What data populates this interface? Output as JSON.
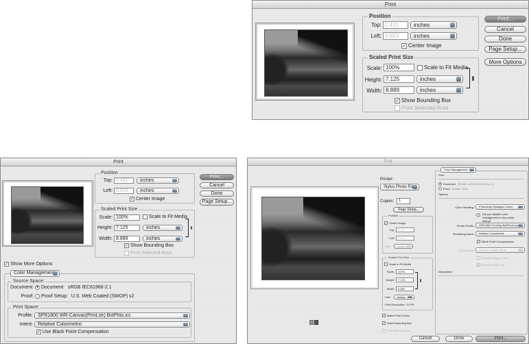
{
  "top": {
    "title": "Print",
    "position": {
      "legend": "Position",
      "top_label": "Top:",
      "top_value": "0.431",
      "left_label": "Left:",
      "left_value": "0.653",
      "unit": "inches",
      "center_image": "Center Image"
    },
    "scaled": {
      "legend": "Scaled Print Size",
      "scale_label": "Scale:",
      "scale_value": "100%",
      "fit": "Scale to Fit Media",
      "height_label": "Height:",
      "height_value": "7.125",
      "width_label": "Width:",
      "width_value": "8.889",
      "unit": "inches",
      "bbox": "Show Bounding Box",
      "selected": "Print Selected Area"
    },
    "buttons": {
      "print": "Print...",
      "cancel": "Cancel",
      "done": "Done",
      "page_setup": "Page Setup...",
      "more": "More Options"
    }
  },
  "left": {
    "title": "Print",
    "position": {
      "legend": "Position",
      "top_label": "Top:",
      "top_value": "0.431",
      "left_label": "Left:",
      "left_value": "0.653",
      "unit": "inches",
      "center_image": "Center Image"
    },
    "scaled": {
      "legend": "Scaled Print Size",
      "scale_label": "Scale:",
      "scale_value": "100%",
      "fit": "Scale to Fit Media",
      "height_label": "Height:",
      "height_value": "7.125",
      "width_label": "Width:",
      "width_value": "8.889",
      "unit": "inches",
      "bbox": "Show Bounding Box",
      "selected": "Print Selected Area"
    },
    "buttons": {
      "print": "Print...",
      "cancel": "Cancel",
      "done": "Done",
      "page_setup": "Page Setup..."
    },
    "show_more": "Show More Options",
    "cm_dropdown": "Color Management",
    "source": {
      "legend": "Source Space:",
      "doc_label": "Document:",
      "doc_option": "Document:",
      "doc_value": "sRGB IEC61966-2.1",
      "proof_label": "Proof:",
      "proof_option": "Proof Setup:",
      "proof_value": "U.S. Web Coated (SWOP) v2"
    },
    "print_space": {
      "legend": "Print Space:",
      "profile_label": "Profile:",
      "profile_value": "SPR1800 WR-Canvas(PrmLstr) BstPhto.icc",
      "intent_label": "Intent:",
      "intent_value": "Relative Colorimetric",
      "bpc": "Use Black Point Compensation"
    }
  },
  "right": {
    "title": "Print",
    "printer_label": "Printer:",
    "printer_value": "Stylus Photo R1...",
    "copies_label": "Copies:",
    "copies_value": "1",
    "page_setup": "Page Setup...",
    "position": {
      "legend": "Position",
      "center_image": "Center Image",
      "top_label": "Top:",
      "top_value": "0.431",
      "left_label": "Left:",
      "left_value": "0.653",
      "unit_label": "Unit:",
      "unit_value": "inches"
    },
    "scaled": {
      "legend": "Scaled Print Size",
      "fit": "Scale to Fit Media",
      "scale_label": "Scale:",
      "scale_value": "100%",
      "height_label": "Height:",
      "height_value": "7.125",
      "width_label": "Width:",
      "width_value": "8.889",
      "unit_label": "Unit:",
      "unit_value": "inches",
      "resolution": "Print Resolution: 72 PPI"
    },
    "match": "Match Print Colors",
    "bbox": "Show Bounding Box",
    "selected": "Print Selected Area",
    "panel": {
      "dropdown": "Color Management",
      "print_heading": "Print",
      "doc_option": "Document",
      "doc_profile": "(Profile: sRGB IEC61966-2.1)",
      "proof_option": "Proof",
      "proof_profile": "(Profile: N/A)",
      "options_heading": "Options",
      "handling_label": "Color Handling:",
      "handling_value": "Photoshop Manages Colors",
      "warning": "Did you disable color management in the printer dialog?",
      "profile_label": "Printer Profile:",
      "profile_value": "SPR1800 PrmGlsy BstPhoto.icc",
      "intent_label": "Rendering Intent:",
      "intent_value": "Relative Colorimetric",
      "bpc": "Black Point Compensation",
      "proof_label": "Proof Setup:",
      "proof_value": "Current Custom Setup",
      "paper": "Simulate Paper Color",
      "ink": "Simulate Black Ink",
      "description": "Description"
    },
    "buttons": {
      "cancel": "Cancel",
      "done": "Done",
      "print": "Print..."
    }
  }
}
